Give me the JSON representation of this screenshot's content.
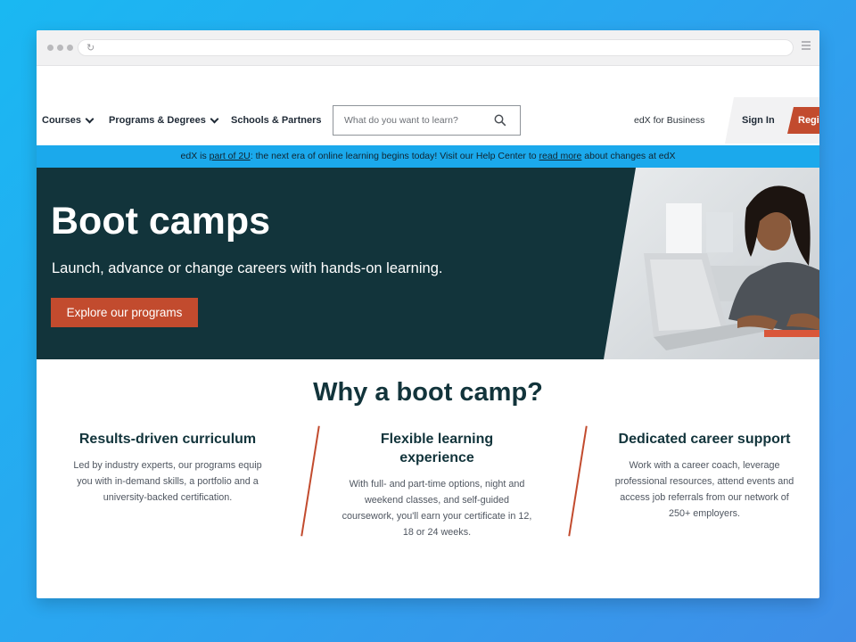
{
  "nav": {
    "courses": "Courses",
    "programs": "Programs & Degrees",
    "schools": "Schools & Partners",
    "search_placeholder": "What do you want to learn?",
    "business": "edX for Business",
    "sign_in": "Sign In",
    "register": "Regi"
  },
  "banner": {
    "part1": "edX is ",
    "link1": "part of 2U",
    "part2": ": the next era of online learning begins today! Visit our Help Center to ",
    "link2": "read more",
    "part3": " about changes at edX"
  },
  "hero": {
    "title": "Boot camps",
    "subtitle": "Launch, advance or change careers with hands-on learning.",
    "button": "Explore our programs"
  },
  "why": {
    "title": "Why a boot camp?",
    "columns": [
      {
        "heading": "Results-driven curriculum",
        "lines": [
          "Led by industry experts, our programs equip",
          "you with in-demand skills, a portfolio and a",
          "university-backed certification."
        ]
      },
      {
        "heading_lines": [
          "Flexible learning",
          "experience"
        ],
        "lines": [
          "With full- and part-time options, night and",
          "weekend classes, and self-guided",
          "coursework, you'll earn your certificate in 12,",
          "18 or 24 weeks."
        ]
      },
      {
        "heading": "Dedicated career support",
        "lines": [
          "Work with a career coach, leverage",
          "professional resources, attend events and",
          "access job referrals from our network of",
          "250+ employers."
        ]
      }
    ]
  },
  "colors": {
    "accent": "#c24b2e",
    "banner": "#1ba9ec",
    "hero_bg": "#12343b",
    "heading": "#12343b"
  }
}
